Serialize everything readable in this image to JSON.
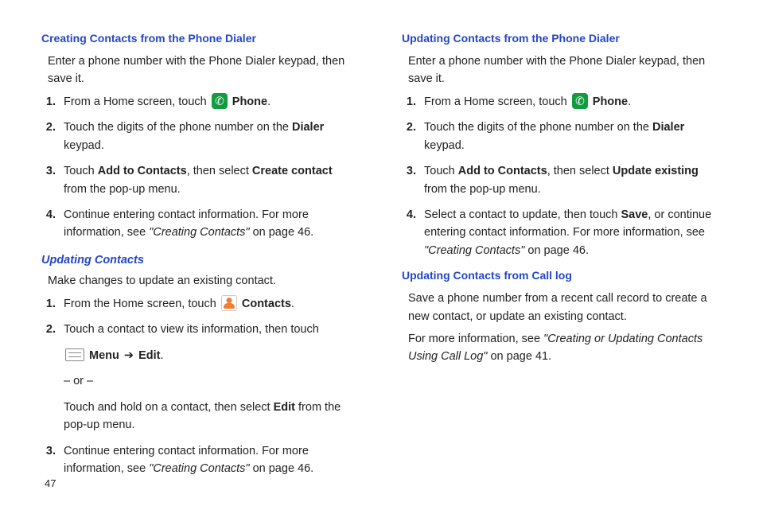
{
  "pageNumber": "47",
  "left": {
    "h1": "Creating Contacts from the Phone Dialer",
    "intro": "Enter a phone number with the Phone Dialer keypad, then save it.",
    "s1a": "From a Home screen, touch ",
    "s1b": "Phone",
    "s1c": ".",
    "s2a": "Touch the digits of the phone number on the ",
    "s2b": "Dialer",
    "s2c": " keypad.",
    "s3a": "Touch ",
    "s3b": "Add to Contacts",
    "s3c": ", then select ",
    "s3d": "Create contact",
    "s3e": " from the pop-up menu.",
    "s4a": "Continue entering contact information. For more information, see ",
    "s4b": "\"Creating Contacts\"",
    "s4c": " on page 46.",
    "h2": "Updating Contacts",
    "intro2": "Make changes to update an existing contact.",
    "u1a": "From the Home screen, touch ",
    "u1b": "Contacts",
    "u1c": ".",
    "u2a": "Touch a contact to view its information, then touch ",
    "u2b": "Menu",
    "u2arrow": "➔",
    "u2c": "Edit",
    "u2d": ".",
    "u2or": "– or –",
    "u2e": "Touch and hold on a contact, then select ",
    "u2f": "Edit",
    "u2g": " from the pop-up menu.",
    "u3a": "Continue entering contact information. For more information, see ",
    "u3b": "\"Creating Contacts\"",
    "u3c": " on page 46."
  },
  "right": {
    "h1": "Updating Contacts from the Phone Dialer",
    "intro": "Enter a phone number with the Phone Dialer keypad, then save it.",
    "s1a": "From a Home screen, touch ",
    "s1b": "Phone",
    "s1c": ".",
    "s2a": "Touch the digits of the phone number on the ",
    "s2b": "Dialer",
    "s2c": " keypad.",
    "s3a": "Touch ",
    "s3b": "Add to Contacts",
    "s3c": ", then select ",
    "s3d": "Update  existing",
    "s3e": " from the pop-up menu.",
    "s4a": "Select a contact to update, then touch ",
    "s4b": "Save",
    "s4c": ", or continue entering contact information. For more information, see ",
    "s4d": "\"Creating Contacts\"",
    "s4e": " on page 46.",
    "h2": "Updating Contacts from Call log",
    "intro2": "Save a phone number from a recent call record to create a new contact, or update an existing contact.",
    "p3a": "For more information, see ",
    "p3b": "\"Creating or Updating Contacts Using Call Log\"",
    "p3c": " on page 41."
  }
}
